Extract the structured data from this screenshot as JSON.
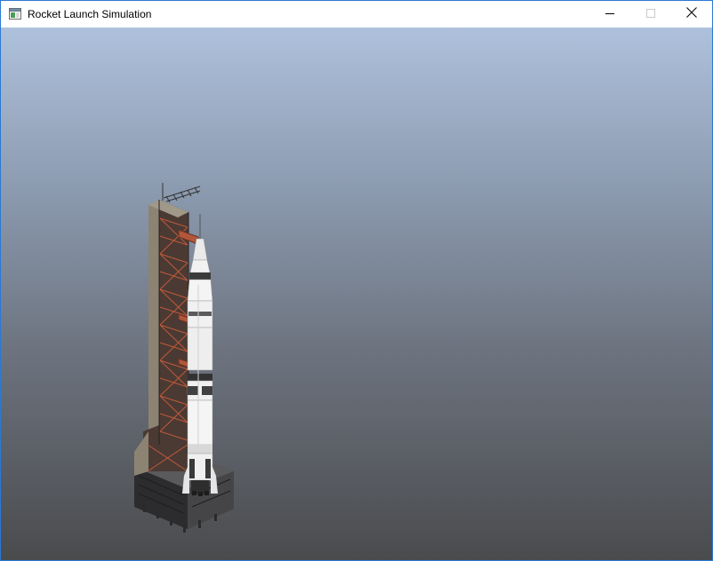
{
  "window": {
    "title": "Rocket Launch Simulation",
    "icon": "app-window-icon",
    "border_color": "#2b79d3"
  },
  "controls": {
    "minimize_icon": "minimize-icon",
    "maximize_icon": "maximize-icon",
    "close_icon": "close-icon"
  },
  "viewport": {
    "sky_top_color": "#aec1dc",
    "sky_bottom_color": "#4a4b4d",
    "objects": [
      "launch-tower",
      "rocket",
      "launch-platform"
    ]
  },
  "colors": {
    "tower_frame": "#5a4a3e",
    "tower_truss": "#c0593a",
    "rocket_body": "#f2f2f2",
    "rocket_bands": "#2e2e2e",
    "platform": "#3d3d3f"
  }
}
